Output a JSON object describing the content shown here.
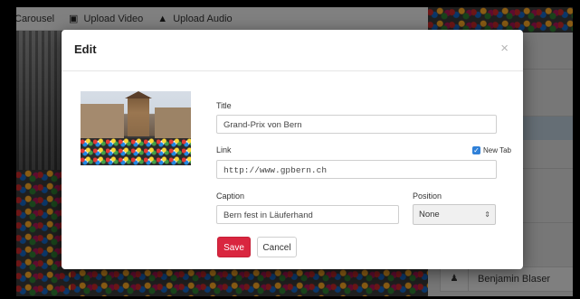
{
  "toolbar": {
    "items": [
      {
        "label": "Carousel",
        "icon": "none"
      },
      {
        "label": "Upload Video",
        "icon": "upload-video-icon"
      },
      {
        "label": "Upload Audio",
        "icon": "upload-audio-icon"
      }
    ]
  },
  "background": {
    "user_name": "Benjamin Blaser"
  },
  "modal": {
    "title": "Edit",
    "close": "×",
    "title_label": "Title",
    "title_value": "Grand-Prix von Bern",
    "link_label": "Link",
    "link_value": "http://www.gpbern.ch",
    "new_tab_label": "New Tab",
    "new_tab_checked": true,
    "caption_label": "Caption",
    "caption_value": "Bern fest in Läuferhand",
    "position_label": "Position",
    "position_value": "None",
    "save_label": "Save",
    "cancel_label": "Cancel"
  },
  "colors": {
    "save_button": "#d9263f",
    "checkbox": "#2f80d8"
  }
}
